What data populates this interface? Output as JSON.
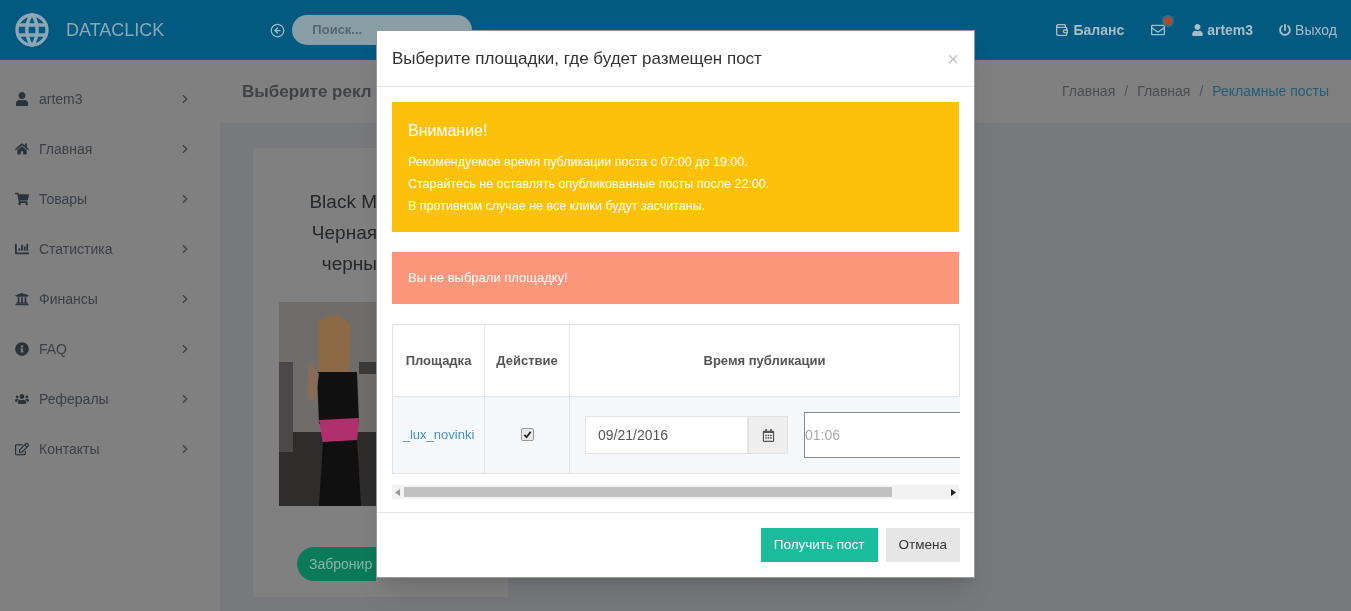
{
  "header": {
    "logo": "DATACLICK",
    "search": {
      "placeholder": "Поиск..."
    },
    "balance": "Баланс",
    "mail_unread": true,
    "user": "artem3",
    "logout": "Выход"
  },
  "sidebar": {
    "items": [
      {
        "kind": "user",
        "label": "artem3"
      },
      {
        "kind": "home",
        "label": "Главная"
      },
      {
        "kind": "cart",
        "label": "Товары"
      },
      {
        "kind": "chart",
        "label": "Статистика"
      },
      {
        "kind": "bank",
        "label": "Финансы"
      },
      {
        "kind": "info",
        "label": "FAQ"
      },
      {
        "kind": "users",
        "label": "Рефералы"
      },
      {
        "kind": "edit",
        "label": "Контакты"
      }
    ]
  },
  "page": {
    "title": "Выберите рекл",
    "breadcrumb_separator": "/",
    "breadcrumbs": [
      {
        "label": "Главная",
        "selected": false
      },
      {
        "label": "Главная",
        "selected": false
      },
      {
        "label": "Рекламные посты",
        "selected": true
      }
    ],
    "card": {
      "title_lines": [
        "Black M",
        "Черная",
        "черны"
      ],
      "button": "Забронир"
    }
  },
  "modal": {
    "title": "Выберите площадки, где будет размещен пост",
    "close": "×",
    "warning": {
      "heading": "Внимание!",
      "lines": [
        "Рекомендуемое время публикации поста с 07:00 до 19:00.",
        "Старайтесь не оставлять опубликованные посты после 22:00.",
        "В противном случае не все клики будут засчитаны."
      ]
    },
    "error": "Вы не выбрали площадку!",
    "table": {
      "columns": [
        "Площадка",
        "Действие",
        "Время публикации"
      ],
      "rows": [
        {
          "site": "_lux_novinki",
          "checked": true,
          "date": "09/21/2016",
          "time": "01:06"
        }
      ]
    },
    "buttons": [
      {
        "kind": "primary",
        "label": "Получить пост"
      },
      {
        "kind": "default",
        "label": "Отмена"
      }
    ]
  }
}
